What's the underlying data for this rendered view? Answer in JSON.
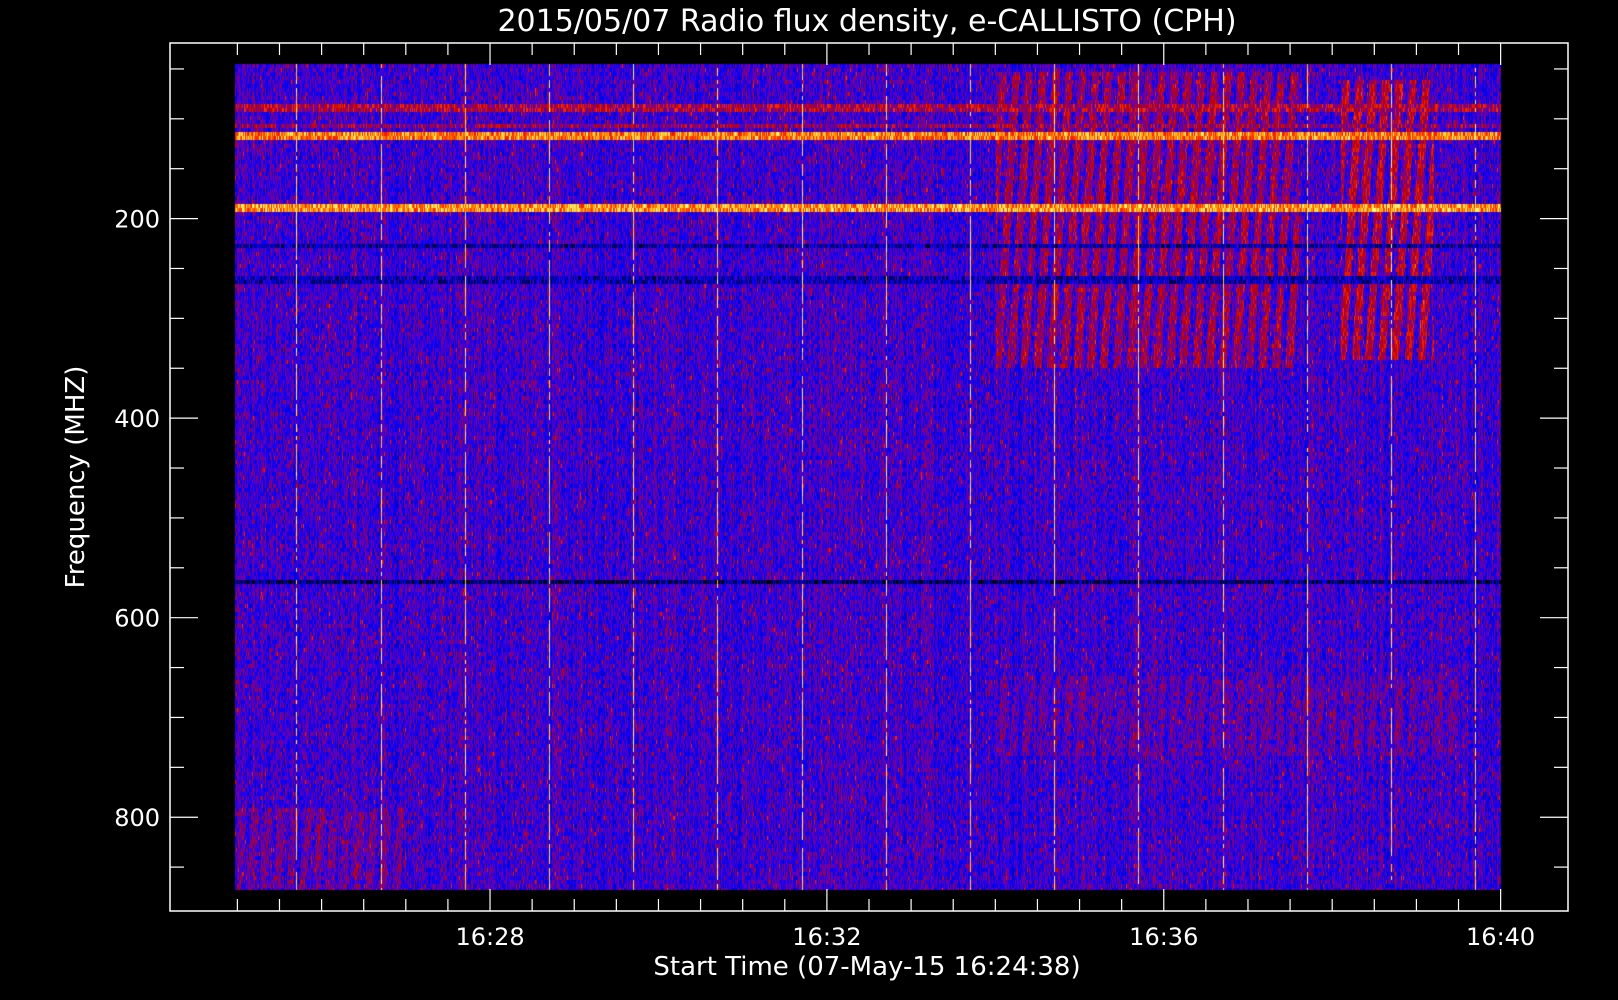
{
  "chart_data": {
    "type": "heatmap",
    "title": "2015/05/07  Radio flux density, e-CALLISTO (CPH)",
    "xlabel": "Start Time (07-May-15 16:24:38)",
    "ylabel": "Frequency (MHZ)",
    "x_units": "minutes after 16:00 UT",
    "xlim": [
      24.2,
      40.8
    ],
    "data_x_range": [
      24.97,
      40.0
    ],
    "ylim": [
      894,
      24
    ],
    "data_y_range": [
      45,
      873
    ],
    "x_major_ticks": [
      {
        "value": 28,
        "label": "16:28"
      },
      {
        "value": 32,
        "label": "16:32"
      },
      {
        "value": 36,
        "label": "16:36"
      },
      {
        "value": 40,
        "label": "16:40"
      }
    ],
    "x_minor_step_minutes": 0.5,
    "y_major_ticks": [
      {
        "value": 200,
        "label": "200"
      },
      {
        "value": 400,
        "label": "400"
      },
      {
        "value": 600,
        "label": "600"
      },
      {
        "value": 800,
        "label": "800"
      }
    ],
    "y_minor_step": 50,
    "colormap": [
      "#000000",
      "#00008c",
      "#0000ff",
      "#6a00b0",
      "#c00000",
      "#ff3000",
      "#ff9a00",
      "#ffff80"
    ],
    "background_level": 0.36,
    "horizontal_bands": [
      {
        "freq_mhz": 90,
        "level": 0.55
      },
      {
        "freq_mhz": 108,
        "level": 0.5
      },
      {
        "freq_mhz": 118,
        "level": 0.82
      },
      {
        "freq_mhz": 190,
        "level": 0.85
      },
      {
        "freq_mhz": 228,
        "level": 0.2
      },
      {
        "freq_mhz": 262,
        "level": 0.22
      },
      {
        "freq_mhz": 565,
        "level": 0.12
      }
    ],
    "vertical_spikes_min": [
      25.7,
      26.7,
      27.7,
      28.7,
      29.7,
      30.7,
      31.7,
      32.7,
      33.7,
      34.7,
      35.7,
      36.7,
      37.7,
      38.7,
      39.7
    ],
    "burst_regions": [
      {
        "t_start": 34.0,
        "t_end": 37.6,
        "f_low": 55,
        "f_high": 350,
        "level": 0.62
      },
      {
        "t_start": 38.1,
        "t_end": 39.2,
        "f_low": 60,
        "f_high": 340,
        "level": 0.7
      },
      {
        "t_start": 34.0,
        "t_end": 39.5,
        "f_low": 660,
        "f_high": 740,
        "level": 0.47
      },
      {
        "t_start": 25.0,
        "t_end": 27.0,
        "f_low": 790,
        "f_high": 873,
        "level": 0.5
      }
    ]
  }
}
